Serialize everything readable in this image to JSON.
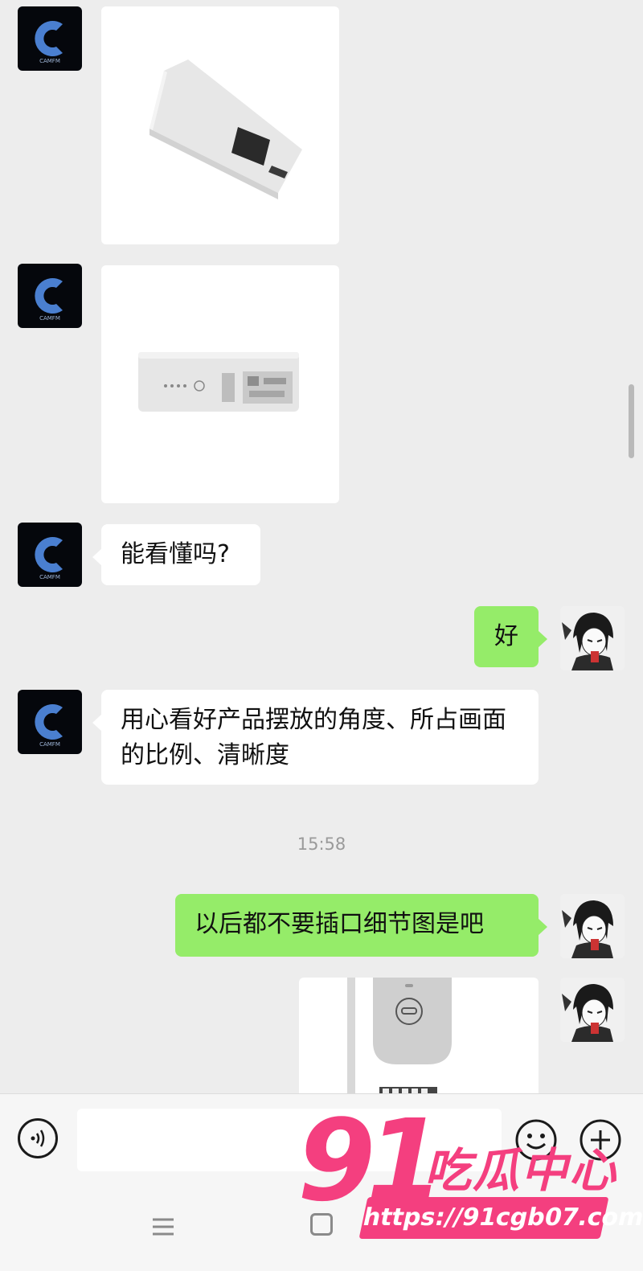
{
  "messages": {
    "msg3_text": "能看懂吗?",
    "msg4_text": "好",
    "msg5_text": "用心看好产品摆放的角度、所占画面的比例、清晰度",
    "timestamp": "15:58",
    "msg6_text": "以后都不要插口细节图是吧"
  },
  "avatar": {
    "contact_logo_text": "CAMFM"
  },
  "input": {
    "value": ""
  },
  "watermark": {
    "number": "91",
    "name": "吃瓜中心",
    "url": "https://91cgb07.com"
  },
  "colors": {
    "background": "#ededed",
    "sent_bubble": "#95ec69",
    "received_bubble": "#ffffff",
    "watermark": "#f43f7f"
  },
  "icons": [
    "voice-icon",
    "emoji-icon",
    "plus-icon",
    "nav-menu-icon",
    "nav-home-icon"
  ]
}
